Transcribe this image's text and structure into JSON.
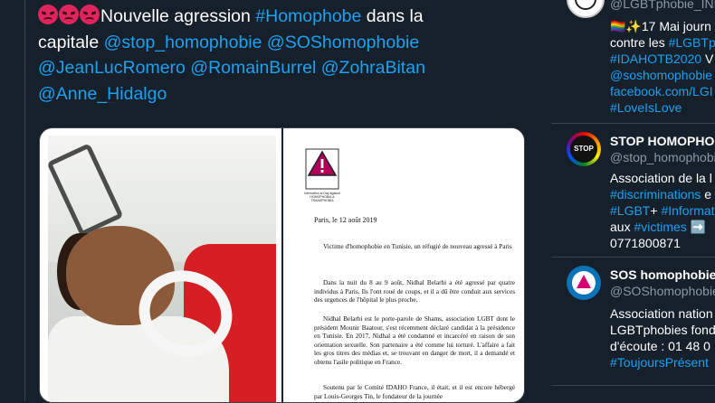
{
  "tweet": {
    "emojis": [
      "pouting-face",
      "pouting-face",
      "pouting-face"
    ],
    "text_lines": [
      [
        {
          "t": "Nouvelle agression ",
          "link": false
        },
        {
          "t": "#Homophobe",
          "link": true
        },
        {
          "t": " dans la",
          "link": false
        }
      ],
      [
        {
          "t": "capitale ",
          "link": false
        },
        {
          "t": "@stop_homophobie",
          "link": true
        },
        {
          "t": " ",
          "link": false
        },
        {
          "t": "@SOShomophobie",
          "link": true
        }
      ],
      [
        {
          "t": "@JeanLucRomero",
          "link": true
        },
        {
          "t": " ",
          "link": false
        },
        {
          "t": "@RomainBurrel",
          "link": true
        },
        {
          "t": " ",
          "link": false
        },
        {
          "t": "@ZohraBitan",
          "link": true
        }
      ],
      [
        {
          "t": "@Anne_Hidalgo",
          "link": true
        }
      ]
    ]
  },
  "letter": {
    "logo_caption": "Internation al Day against HOMOPHOBIA & TRANSPHOBIA",
    "date": "Paris, le 12 août 2019",
    "subject": "Victime d'homophobie en Tunisie, un réfugié de nouveau agressé à Paris",
    "para1": "Dans la nuit du 8 au 9 août, Nidhal Belarbi a été agressé par quatre individus à Paris. Ils l'ont roué de coups, et il a dû être conduit aux services des urgences de l'hôpital le plus proche.",
    "para2": "Nidhal Belarbi est le porte-parole de Shams, association LGBT dont le président Mounir Baatour, s'est récemment déclaré candidat à la présidence en Tunisie. En 2017, Nidhal a été condamné et incarcéré en raison de son orientation sexuelle. Son partenaire a été comme lui torturé. L'affaire a fait les gros titres des médias et, se trouvant en danger de mort, il a demandé et obtenu l'asile politique en France.",
    "para3": "Soutenu par le Comité IDAHO France, il était, et il est encore hébergé par Louis-Georges Tin, le fondateur de la journée"
  },
  "sidebar": {
    "accounts": [
      {
        "name": "",
        "handle": "@LGBTphobie_INF",
        "bio_lines": [
          [
            {
              "t": "🏳️‍🌈✨17 Mai journ",
              "link": false
            }
          ],
          [
            {
              "t": "contre les ",
              "link": false
            },
            {
              "t": "#LGBTp",
              "link": true
            }
          ],
          [
            {
              "t": "#IDAHOTB2020",
              "link": true
            },
            {
              "t": " V",
              "link": false
            }
          ],
          [
            {
              "t": "@soshomophobie",
              "link": true
            }
          ],
          [
            {
              "t": "facebook.com/LGI",
              "link": true
            }
          ],
          [
            {
              "t": "#LoveIsLove",
              "link": true
            }
          ]
        ]
      },
      {
        "name": "STOP HOMOPHO",
        "handle": "@stop_homophobi",
        "avatar_text": "STOP",
        "bio_lines": [
          [
            {
              "t": "Association de la l",
              "link": false
            }
          ],
          [
            {
              "t": "#discriminations",
              "link": true
            },
            {
              "t": " e",
              "link": false
            }
          ],
          [
            {
              "t": "#LGBT",
              "link": true
            },
            {
              "t": "+ ",
              "link": false
            },
            {
              "t": "#Informat",
              "link": true
            }
          ],
          [
            {
              "t": "aux ",
              "link": false
            },
            {
              "t": "#victimes",
              "link": true
            },
            {
              "t": " ➡️ ",
              "link": false
            }
          ],
          [
            {
              "t": "0771800871",
              "link": false
            }
          ]
        ]
      },
      {
        "name": "SOS homophobie",
        "handle": "@SOShomophobie",
        "bio_lines": [
          [
            {
              "t": "Association nation",
              "link": false
            }
          ],
          [
            {
              "t": "LGBTphobies fond",
              "link": false
            }
          ],
          [
            {
              "t": "d'écoute : 01 48 0",
              "link": false
            }
          ],
          [
            {
              "t": "#ToujoursPrésent",
              "link": true
            }
          ]
        ]
      }
    ]
  },
  "colors": {
    "background": "#15202b",
    "border": "#38444d",
    "link": "#1da1f2",
    "muted": "#8899a6",
    "text": "#ffffff"
  }
}
